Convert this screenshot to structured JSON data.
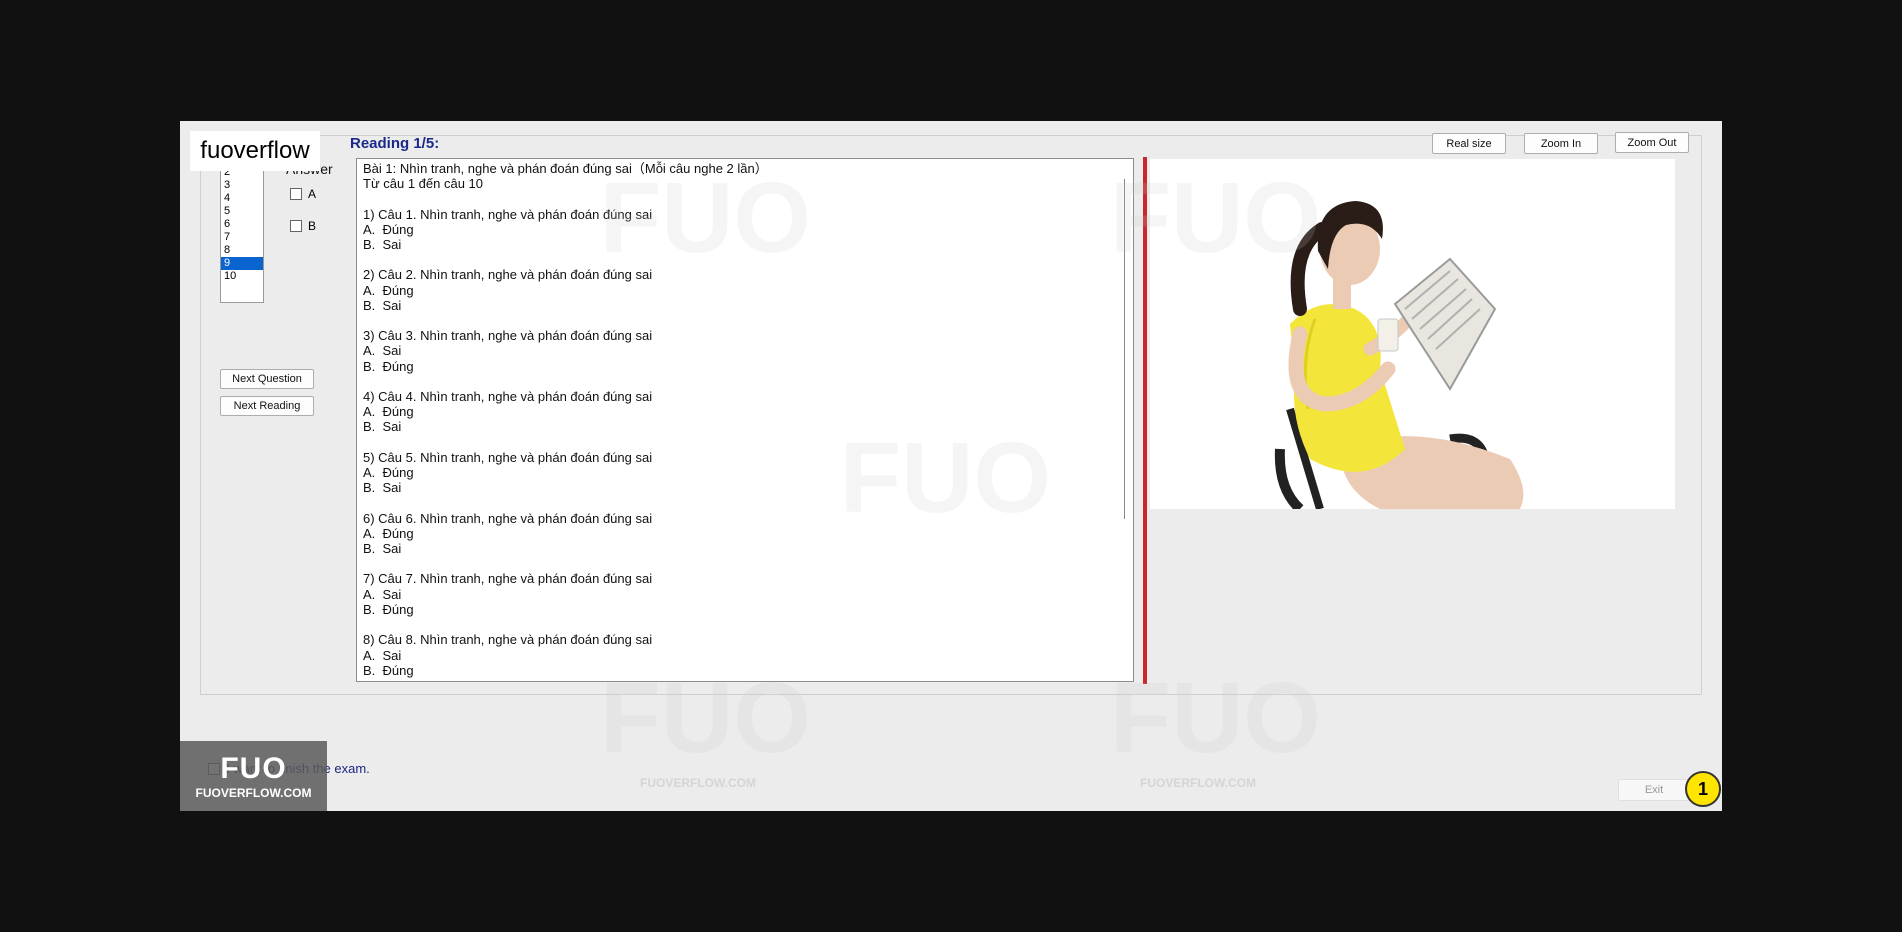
{
  "brand": {
    "top_label": "fuoverflow",
    "logo_big": "FUO",
    "logo_small": "FUOVERFLOW.COM"
  },
  "question_list": [
    "2",
    "3",
    "4",
    "5",
    "6",
    "7",
    "8",
    "9",
    "10"
  ],
  "selected_question": "9",
  "answer": {
    "label": "Answer",
    "options": [
      "A",
      "B"
    ]
  },
  "buttons": {
    "next_question": "Next Question",
    "next_reading": "Next Reading",
    "real_size": "Real size",
    "zoom_in": "Zoom In",
    "zoom_out": "Zoom Out",
    "exit": "Exit"
  },
  "reading": {
    "title": "Reading 1/5:",
    "lines": [
      "Bài 1: Nhìn tranh, nghe và phán đoán đúng sai（Mỗi câu nghe 2 lần）",
      "Từ câu 1 đến câu 10",
      "",
      "1) Câu 1. Nhìn tranh, nghe và phán đoán đúng sai",
      "A.  Đúng",
      "B.  Sai",
      "",
      "2) Câu 2. Nhìn tranh, nghe và phán đoán đúng sai",
      "A.  Đúng",
      "B.  Sai",
      "",
      "3) Câu 3. Nhìn tranh, nghe và phán đoán đúng sai",
      "A.  Sai",
      "B.  Đúng",
      "",
      "4) Câu 4. Nhìn tranh, nghe và phán đoán đúng sai",
      "A.  Đúng",
      "B.  Sai",
      "",
      "5) Câu 5. Nhìn tranh, nghe và phán đoán đúng sai",
      "A.  Đúng",
      "B.  Sai",
      "",
      "6) Câu 6. Nhìn tranh, nghe và phán đoán đúng sai",
      "A.  Đúng",
      "B.  Sai",
      "",
      "7) Câu 7. Nhìn tranh, nghe và phán đoán đúng sai",
      "A.  Sai",
      "B.  Đúng",
      "",
      "8) Câu 8. Nhìn tranh, nghe và phán đoán đúng sai",
      "A.  Sai",
      "B.  Đúng"
    ]
  },
  "finish": {
    "label": "I want to finish the exam."
  },
  "badge": "1",
  "watermarks": [
    "FUO",
    "FUOVERFLOW.COM"
  ],
  "colors": {
    "accent_blue": "#1b2a8a",
    "selection": "#0a64d0",
    "divider": "#c8282c",
    "badge": "#ffe400"
  }
}
